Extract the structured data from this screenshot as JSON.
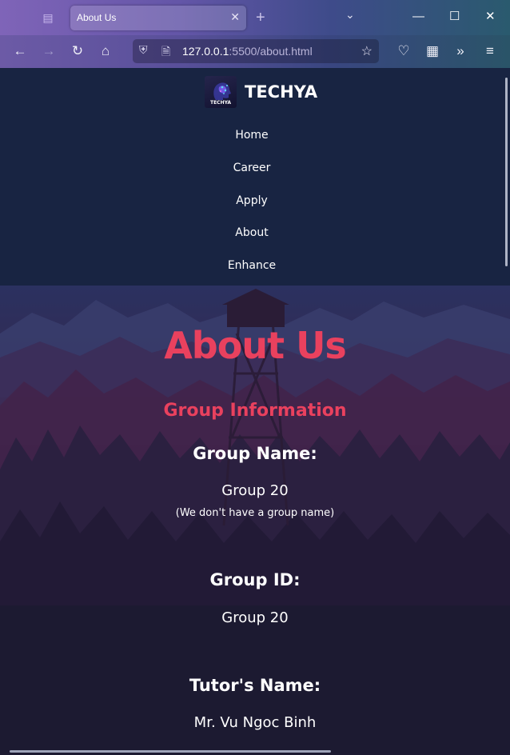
{
  "browser": {
    "tab_title": "About Us",
    "url_host": "127.0.0.1",
    "url_rest": ":5500/about.html",
    "icons": {
      "tab_overview": "tab-overview-icon",
      "close": "close-icon",
      "new_tab": "plus-icon",
      "list_tabs": "chevron-down-icon",
      "back": "back-arrow-icon",
      "forward": "forward-arrow-icon",
      "reload": "reload-icon",
      "home": "home-icon",
      "shield": "shield-icon",
      "page": "page-icon",
      "bookmark": "star-icon",
      "pocket": "pocket-icon",
      "extensions": "puzzle-icon",
      "overflow": "double-chevron-icon",
      "menu": "hamburger-icon"
    }
  },
  "site": {
    "brand": "TECHYA",
    "logo_text": "TECHYA",
    "menu": [
      {
        "label": "Home"
      },
      {
        "label": "Career"
      },
      {
        "label": "Apply"
      },
      {
        "label": "About"
      },
      {
        "label": "Enhance"
      }
    ]
  },
  "about": {
    "title": "About Us",
    "section_title": "Group Information",
    "group_name_label": "Group Name:",
    "group_name_value": "Group 20",
    "group_name_note": "(We don't have a group name)",
    "group_id_label": "Group ID:",
    "group_id_value": "Group 20",
    "tutor_label": "Tutor's Name:",
    "tutor_value": "Mr. Vu Ngoc Binh"
  },
  "colors": {
    "header_bg": "#182442",
    "accent": "#e9415e",
    "text": "#ffffff"
  }
}
